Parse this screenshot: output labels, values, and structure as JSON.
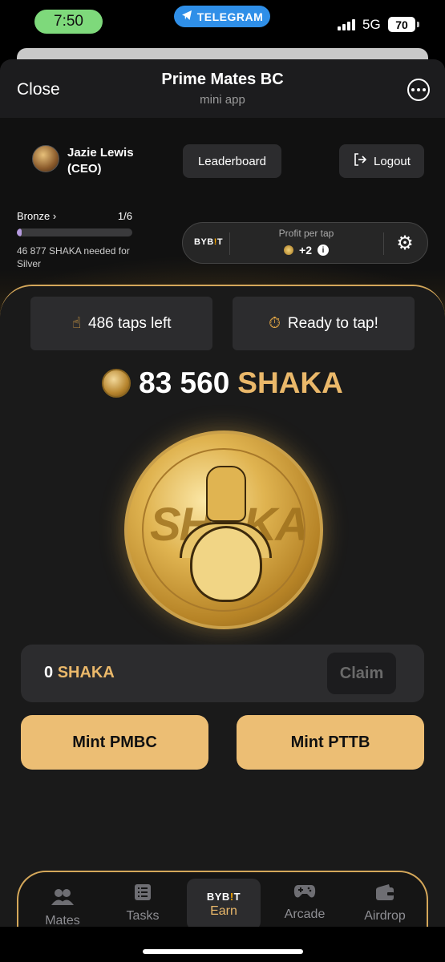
{
  "status": {
    "time": "7:50",
    "telegram_label": "TELEGRAM",
    "network": "5G",
    "battery": "70"
  },
  "header": {
    "close_label": "Close",
    "title": "Prime Mates BC",
    "subtitle": "mini app"
  },
  "user": {
    "name": "Jazie Lewis",
    "role": "(CEO)",
    "leaderboard_label": "Leaderboard",
    "logout_label": "Logout"
  },
  "rank": {
    "level": "Bronze",
    "progress_text": "1/6",
    "progress_fraction": 0.04,
    "needed_text": "46 877 SHAKA needed for Silver"
  },
  "profit": {
    "brand_prefix": "BYB",
    "brand_mark": "!",
    "brand_suffix": "T",
    "label": "Profit per tap",
    "value": "+2",
    "info_glyph": "i"
  },
  "stats": {
    "taps_left": "486 taps left",
    "status": "Ready to tap!"
  },
  "balance": {
    "amount": "83 560",
    "currency": "SHAKA"
  },
  "coin": {
    "word": "SHAKA"
  },
  "claim": {
    "amount": "0",
    "currency": "SHAKA",
    "button_label": "Claim"
  },
  "mint": {
    "pmbc_label": "Mint PMBC",
    "pttb_label": "Mint PTTB"
  },
  "nav": {
    "mates": "Mates",
    "tasks": "Tasks",
    "earn": "Earn",
    "arcade": "Arcade",
    "airdrop": "Airdrop"
  },
  "colors": {
    "accent_gold": "#eab86a",
    "button_gold": "#ecbe74",
    "telegram_blue": "#2f8fe8",
    "time_green": "#7ed97b"
  }
}
